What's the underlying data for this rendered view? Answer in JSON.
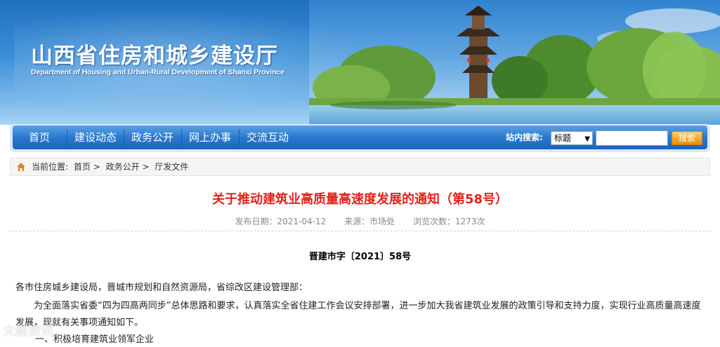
{
  "header": {
    "title": "山西省住房和城乡建设厅",
    "subtitle": "Department of Housing and Urban-Rural Development of Shanxi Province"
  },
  "nav": {
    "items": [
      {
        "label": "首页"
      },
      {
        "label": "建设动态"
      },
      {
        "label": "政务公开"
      },
      {
        "label": "网上办事"
      },
      {
        "label": "交流互动"
      }
    ],
    "search_label": "站内搜索:",
    "search_select": "标题",
    "search_value": "",
    "search_button": "搜索"
  },
  "breadcrumb": {
    "prefix": "当前位置:",
    "items": [
      "首页",
      "政务公开",
      "厅发文件"
    ],
    "separator": ">"
  },
  "article": {
    "title": "关于推动建筑业高质量高速度发展的通知（第58号）",
    "publish_date": "发布日期：2021-04-12",
    "source": "来源：市场处",
    "views": "浏览次数：1273次",
    "doc_number": "晋建市字〔2021〕58号",
    "para1": "各市住房城乡建设局，晋城市规划和自然资源局，省综改区建设管理部：",
    "para2": "为全面落实省委“四为四高两同步”总体思路和要求，认真落实全省住建工作会议安排部署，进一步加大我省建筑业发展的政策引导和支持力度，实现行业高质量高速度发展，现就有关事项通知如下。",
    "para3": "一、积极培育建筑业领军企业"
  },
  "watermark": "大鹏资讯"
}
